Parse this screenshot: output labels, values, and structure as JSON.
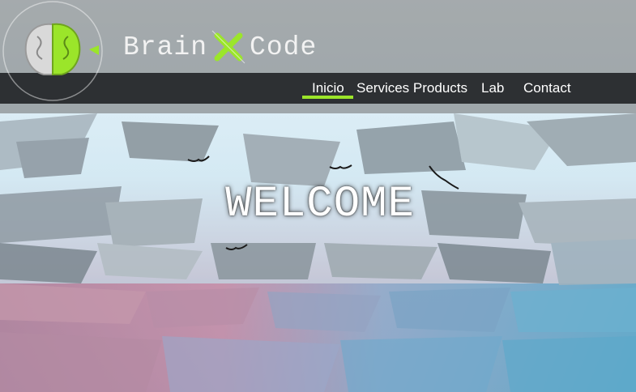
{
  "brand": {
    "left": "Brain",
    "right": "Code",
    "accent": "#9be52a"
  },
  "nav": {
    "items": [
      "Inicio",
      "Services Products",
      "Lab",
      "Contact"
    ],
    "active": "Inicio"
  },
  "hero": {
    "title": "WELCOME"
  },
  "icons": {
    "logo": "brain-logo-icon",
    "x": "x-mark-icon"
  }
}
